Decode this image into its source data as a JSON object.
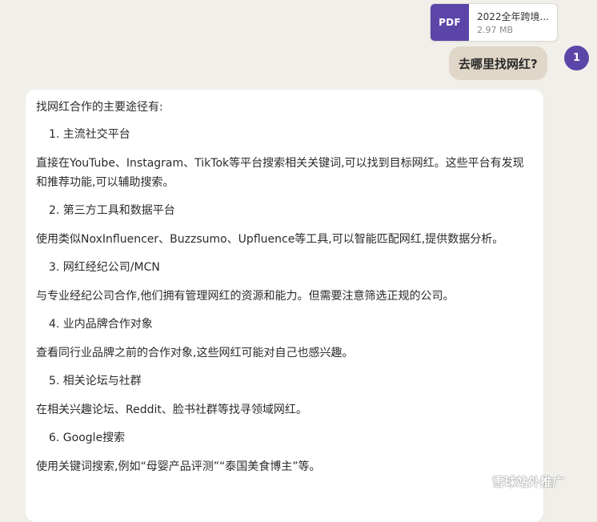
{
  "attachment": {
    "badge": "PDF",
    "file_name": "2022全年跨境...",
    "file_size": "2.97 MB"
  },
  "user_message": {
    "text": "去哪里找网红?",
    "avatar_label": "1"
  },
  "response": {
    "intro": "找网红合作的主要途径有:",
    "sections": [
      {
        "heading": "1. 主流社交平台",
        "body": "直接在YouTube、Instagram、TikTok等平台搜索相关关键词,可以找到目标网红。这些平台有发现和推荐功能,可以辅助搜索。"
      },
      {
        "heading": "2. 第三方工具和数据平台",
        "body": "使用类似NoxInfluencer、Buzzsumo、Upfluence等工具,可以智能匹配网红,提供数据分析。"
      },
      {
        "heading": "3. 网红经纪公司/MCN",
        "body": "与专业经纪公司合作,他们拥有管理网红的资源和能力。但需要注意筛选正规的公司。"
      },
      {
        "heading": "4. 业内品牌合作对象",
        "body": "查看同行业品牌之前的合作对象,这些网红可能对自己也感兴趣。"
      },
      {
        "heading": "5. 相关论坛与社群",
        "body": "在相关兴趣论坛、Reddit、脸书社群等找寻领域网红。"
      },
      {
        "heading": "6. Google搜索",
        "body": "使用关键词搜索,例如“母婴产品评测”“泰国美食博主”等。"
      }
    ]
  },
  "watermark": {
    "text": "雪球站外推广",
    "icon": "wechat-icon"
  },
  "colors": {
    "background": "#f1efe9",
    "accent": "#5b45a8",
    "user_bubble": "#e0d7c8",
    "card": "#ffffff"
  }
}
